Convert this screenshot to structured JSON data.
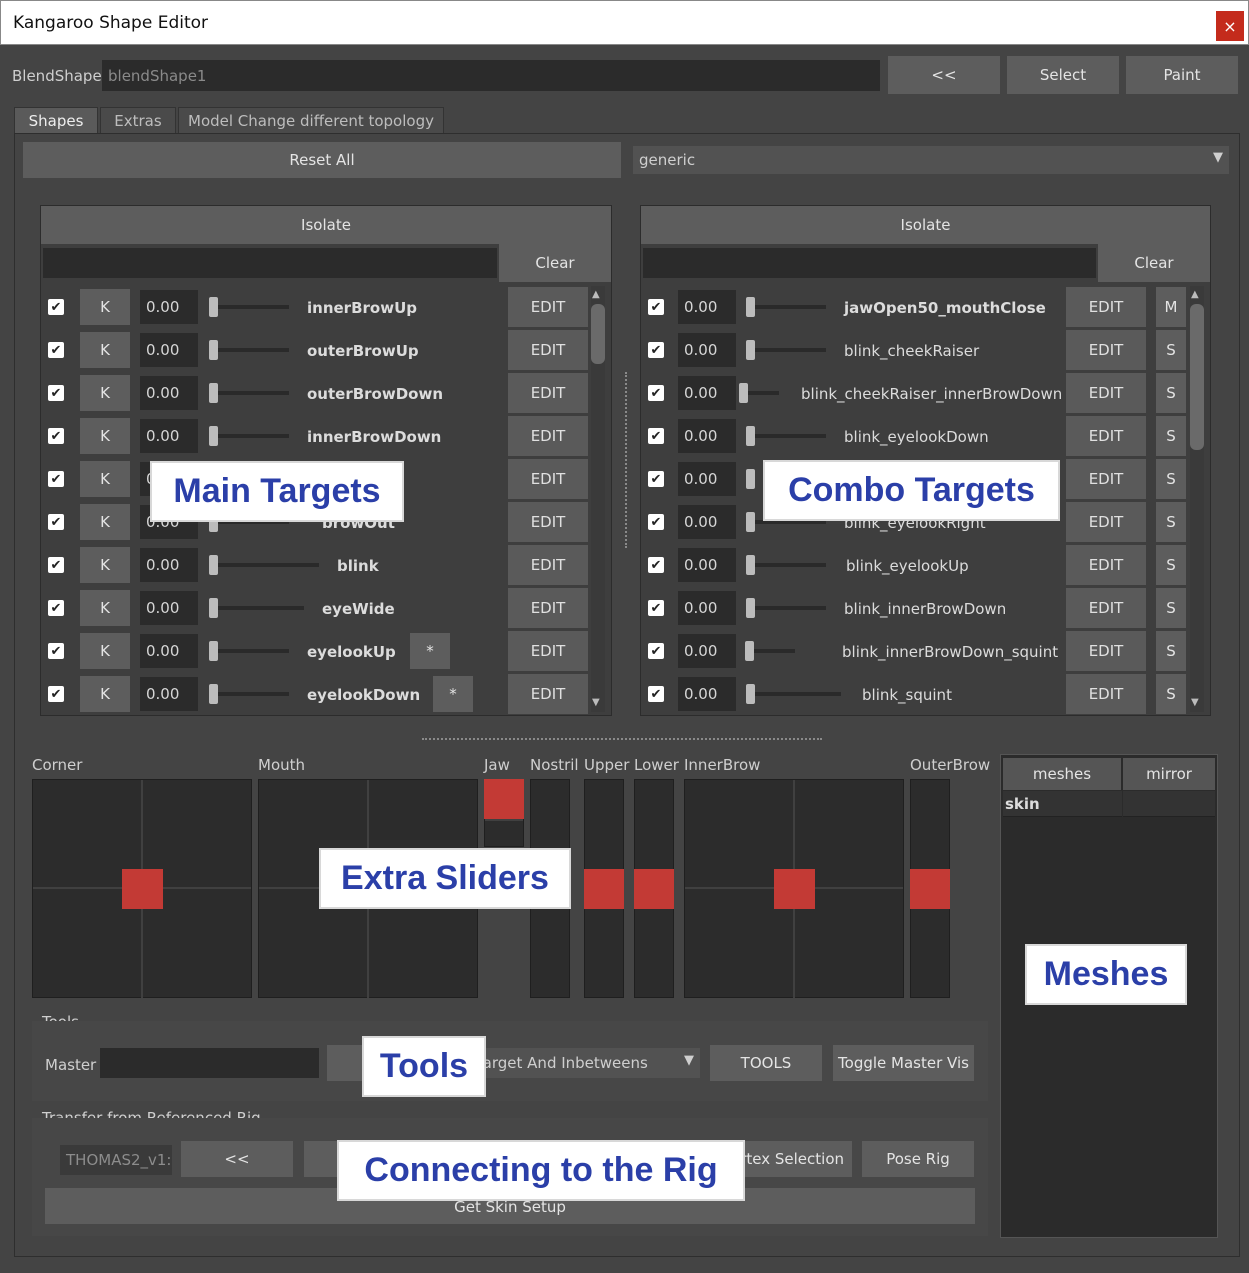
{
  "window": {
    "title": "Kangaroo Shape Editor",
    "close": "×"
  },
  "top": {
    "blendshape_label": "BlendShape",
    "blendshape_value": "blendShape1",
    "prev_label": "<<",
    "select_label": "Select",
    "paint_label": "Paint"
  },
  "tabs": [
    {
      "label": "Shapes"
    },
    {
      "label": "Extras"
    },
    {
      "label": "Model Change different topology"
    }
  ],
  "shapes": {
    "reset_all": "Reset All",
    "filter_value": "generic",
    "dropdown_arrow": "▼"
  },
  "main": {
    "isolate": "Isolate",
    "clear": "Clear",
    "k": "K",
    "edit": "EDIT",
    "rows": [
      {
        "value": "0.00",
        "name": "innerBrowUp",
        "level": 0
      },
      {
        "value": "0.00",
        "name": "outerBrowUp",
        "level": 0
      },
      {
        "value": "0.00",
        "name": "outerBrowDown",
        "level": 0
      },
      {
        "value": "0.00",
        "name": "innerBrowDown",
        "level": 0
      },
      {
        "value": "0.00",
        "name": "",
        "level": 0
      },
      {
        "value": "0.00",
        "name": "browOut",
        "level": 0
      },
      {
        "value": "0.00",
        "name": "blink",
        "level": 0
      },
      {
        "value": "0.00",
        "name": "eyeWide",
        "level": 0
      },
      {
        "value": "0.00",
        "name": "eyelookUp",
        "level": 0,
        "extra": "*"
      },
      {
        "value": "0.00",
        "name": "eyelookDown",
        "level": 0,
        "extra": "*"
      }
    ]
  },
  "combo": {
    "isolate": "Isolate",
    "clear": "Clear",
    "edit": "EDIT",
    "rows": [
      {
        "value": "0.00",
        "name": "jawOpen50_mouthClose",
        "tag": "M",
        "bold": true
      },
      {
        "value": "0.00",
        "name": "blink_cheekRaiser",
        "tag": "S"
      },
      {
        "value": "0.00",
        "name": "blink_cheekRaiser_innerBrowDown",
        "tag": "S"
      },
      {
        "value": "0.00",
        "name": "blink_eyelookDown",
        "tag": "S"
      },
      {
        "value": "0.00",
        "name": "",
        "tag": "S"
      },
      {
        "value": "0.00",
        "name": "blink_eyelookRight",
        "tag": "S"
      },
      {
        "value": "0.00",
        "name": "blink_eyelookUp",
        "tag": "S"
      },
      {
        "value": "0.00",
        "name": "blink_innerBrowDown",
        "tag": "S"
      },
      {
        "value": "0.00",
        "name": "blink_innerBrowDown_squint",
        "tag": "S"
      },
      {
        "value": "0.00",
        "name": "blink_squint",
        "tag": "S"
      }
    ]
  },
  "extra_sliders": {
    "corner": "Corner",
    "mouth": "Mouth",
    "jaw": "Jaw",
    "nostril": "Nostril",
    "upper": "Upper",
    "lower": "Lower",
    "innerbrow": "InnerBrow",
    "outerbrow": "OuterBrow",
    "accent": "#c33a35"
  },
  "meshes": {
    "col_meshes": "meshes",
    "col_mirror": "mirror",
    "item": "skin"
  },
  "tools": {
    "section": "Tools",
    "master_label": "Master",
    "dropdown_value": "Target And Inbetweens",
    "tools_button": "TOOLS",
    "toggle_master": "Toggle Master Vis"
  },
  "transfer": {
    "section": "Transfer from Referenced Rig",
    "rig_field": "THOMAS2_v1:",
    "prev": "<<",
    "vertex_selection": "ertex Selection",
    "pose_rig": "Pose Rig",
    "get_skin": "Get Skin Setup"
  },
  "callouts": {
    "main_targets": "Main Targets",
    "combo_targets": "Combo Targets",
    "extra_sliders": "Extra Sliders",
    "meshes": "Meshes",
    "tools": "Tools",
    "connecting": "Connecting to the Rig"
  }
}
